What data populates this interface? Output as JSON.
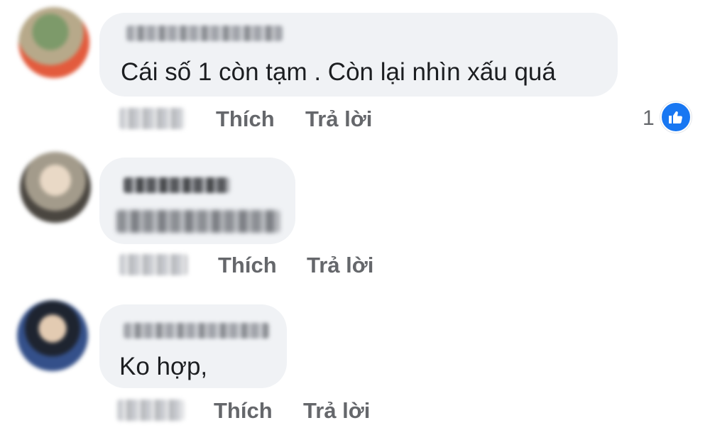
{
  "comments": [
    {
      "text": "Cái số 1 còn tạm . Còn lại nhìn xấu quá",
      "like_label": "Thích",
      "reply_label": "Trả lời",
      "reaction_count": "1",
      "reaction_icon": "like-icon",
      "avatar_colors": [
        "#6b8a5a",
        "#e26a4c",
        "#c9b8a0"
      ]
    },
    {
      "text": "",
      "like_label": "Thích",
      "reply_label": "Trả lời",
      "avatar_colors": [
        "#a89d8c",
        "#e8d8c4",
        "#3f3a35"
      ]
    },
    {
      "text": "Ko hợp,",
      "like_label": "Thích",
      "reply_label": "Trả lời",
      "avatar_colors": [
        "#2a3c6a",
        "#d8c0a8",
        "#1a1a1a"
      ]
    }
  ],
  "accent_color": "#1877f2"
}
